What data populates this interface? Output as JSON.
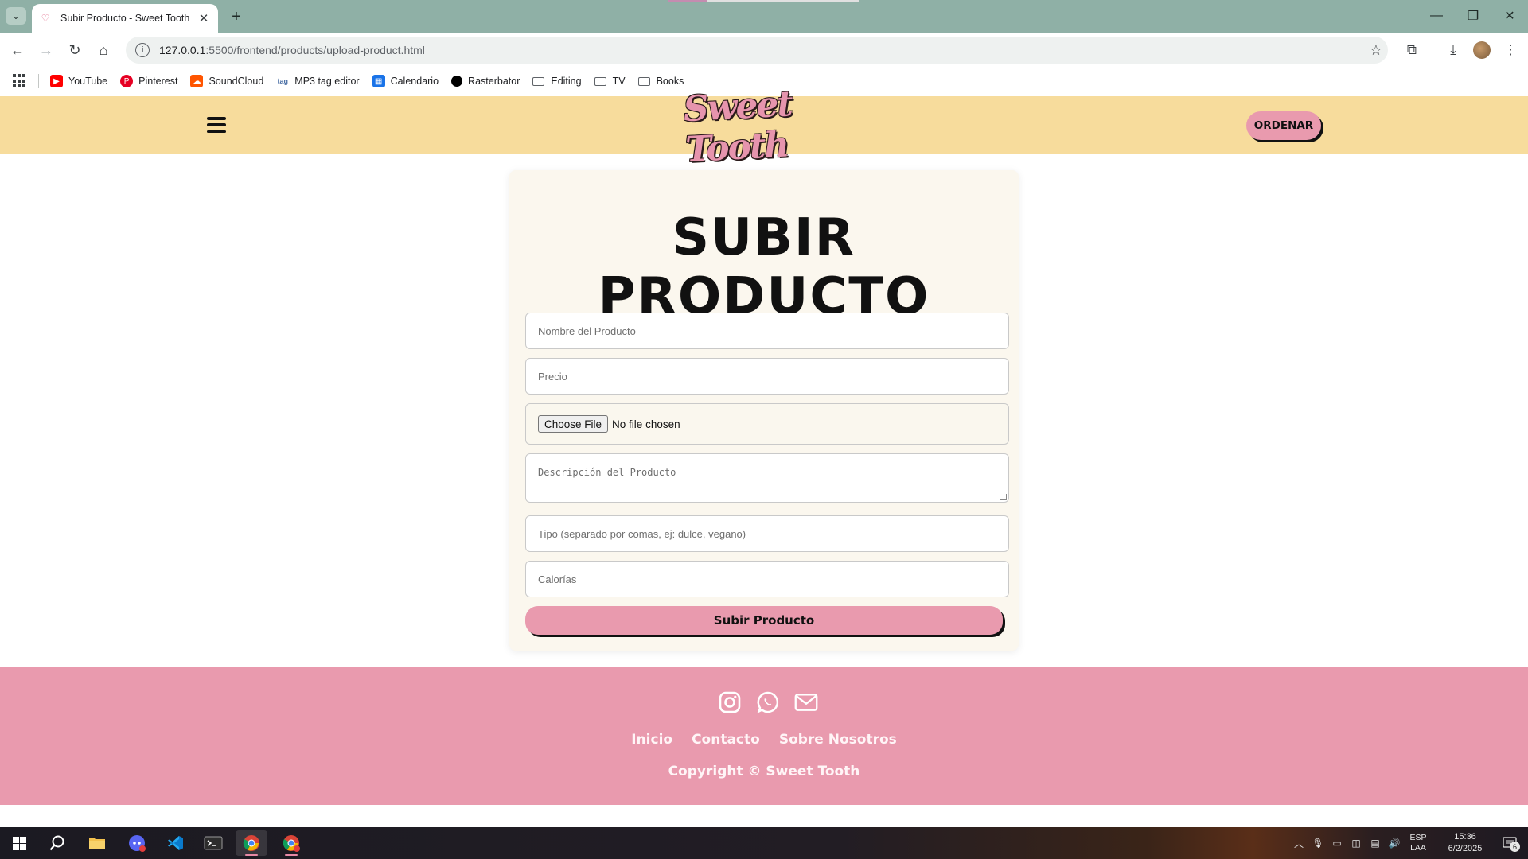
{
  "browser": {
    "tab_title": "Subir Producto - Sweet Tooth",
    "url_host": "127.0.0.1",
    "url_path": ":5500/frontend/products/upload-product.html",
    "bookmarks": [
      {
        "label": "YouTube",
        "icon": "youtube-icon",
        "color": "#ff0000"
      },
      {
        "label": "Pinterest",
        "icon": "pinterest-icon",
        "color": "#e60023"
      },
      {
        "label": "SoundCloud",
        "icon": "soundcloud-icon",
        "color": "#ff5500"
      },
      {
        "label": "MP3 tag editor",
        "icon": "tag-icon",
        "color": "#4a6fa5"
      },
      {
        "label": "Calendario",
        "icon": "calendar-icon",
        "color": "#1a73e8"
      },
      {
        "label": "Rasterbator",
        "icon": "rasterbator-icon",
        "color": "#000000"
      },
      {
        "label": "Editing",
        "icon": "folder-icon"
      },
      {
        "label": "TV",
        "icon": "folder-icon"
      },
      {
        "label": "Books",
        "icon": "folder-icon"
      }
    ]
  },
  "header": {
    "logo": "Sweet Tooth",
    "order_button": "ORDENAR"
  },
  "form": {
    "title": "SUBIR PRODUCTO",
    "name_placeholder": "Nombre del Producto",
    "price_placeholder": "Precio",
    "file_button": "Choose File",
    "file_status": "No file chosen",
    "description_placeholder": "Descripción del Producto",
    "type_placeholder": "Tipo (separado por comas, ej: dulce, vegano)",
    "calories_placeholder": "Calorías",
    "submit_label": "Subir Producto"
  },
  "footer": {
    "social": [
      "instagram-icon",
      "whatsapp-icon",
      "mail-icon"
    ],
    "links": [
      "Inicio",
      "Contacto",
      "Sobre Nosotros"
    ],
    "copyright": "Copyright © Sweet Tooth"
  },
  "taskbar": {
    "language": "ESP",
    "language_sub": "LAA",
    "time": "15:36",
    "date": "6/2/2025",
    "notifications": "6"
  },
  "colors": {
    "header_bg": "#f7dc9c",
    "accent_pink": "#e99aae",
    "card_bg": "#fbf7ee"
  }
}
